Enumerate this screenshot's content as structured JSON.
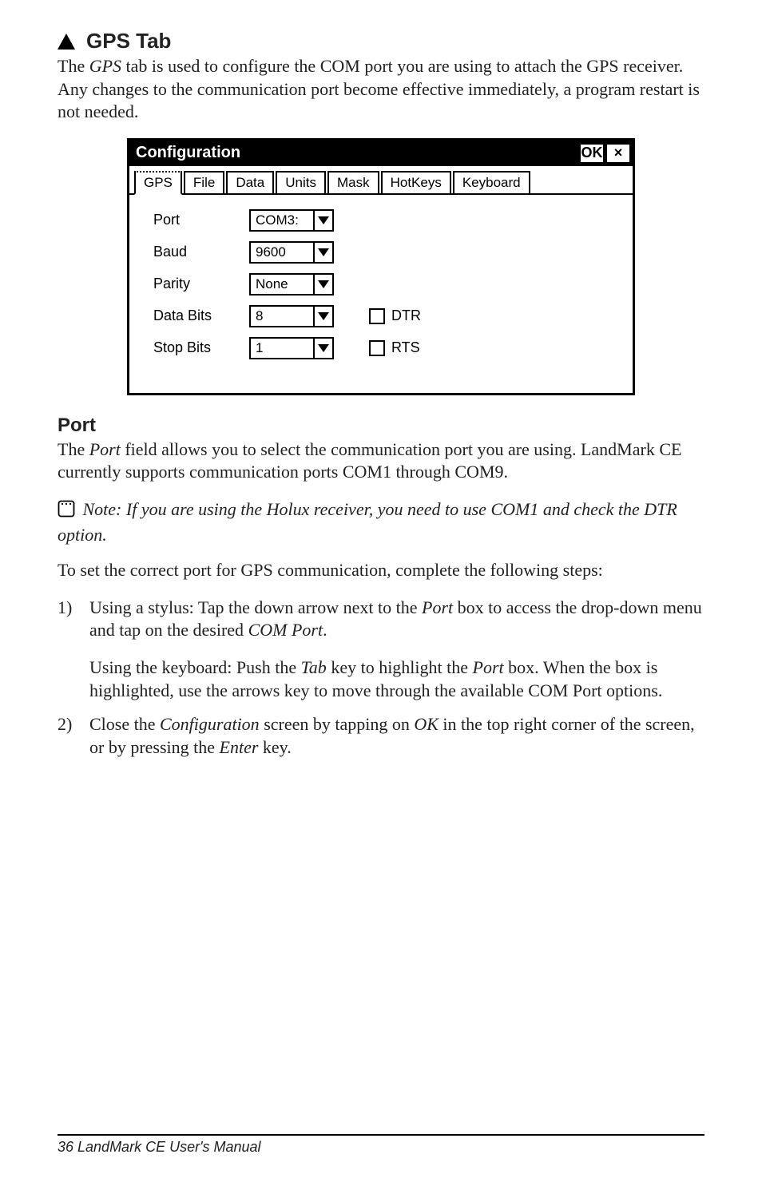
{
  "section": {
    "gps_tab_title": "GPS Tab",
    "intro": "The GPS tab is used to configure the COM port you are using to attach the GPS receiver. Any changes to the communication port become effective immediately, a program restart is not needed."
  },
  "dialog": {
    "title": "Configuration",
    "ok_label": "OK",
    "close_label": "×",
    "tabs": [
      "GPS",
      "File",
      "Data",
      "Units",
      "Mask",
      "HotKeys",
      "Keyboard"
    ],
    "labels": {
      "port": "Port",
      "baud": "Baud",
      "parity": "Parity",
      "data_bits": "Data Bits",
      "stop_bits": "Stop Bits"
    },
    "values": {
      "port": "COM3:",
      "baud": "9600",
      "parity": "None",
      "data_bits": "8",
      "stop_bits": "1"
    },
    "checks": {
      "dtr": "DTR",
      "rts": "RTS"
    }
  },
  "port_section": {
    "title": "Port",
    "body": "The Port field allows you to select the communication port you are using. LandMark CE currently supports communication ports COM1 through COM9.",
    "note": "Note: If you are using the Holux receiver, you need to use COM1 and check the DTR option.",
    "lead": "To set the correct port for GPS communication, complete the following steps:",
    "li1_marker": "1)",
    "li1_a": "Using a stylus: Tap the down arrow next to the Port box to access the drop-down menu and tap on the desired COM Port.",
    "li1_b": "Using the keyboard: Push the Tab key to highlight the Port box. When the box is highlighted, use the arrows key to move through the available COM Port options.",
    "li2_marker": "2)",
    "li2": "Close the Configuration screen by tapping on OK in the top right corner of the screen, or by pressing the Enter key."
  },
  "footer": {
    "text": "36  LandMark CE User's Manual"
  }
}
